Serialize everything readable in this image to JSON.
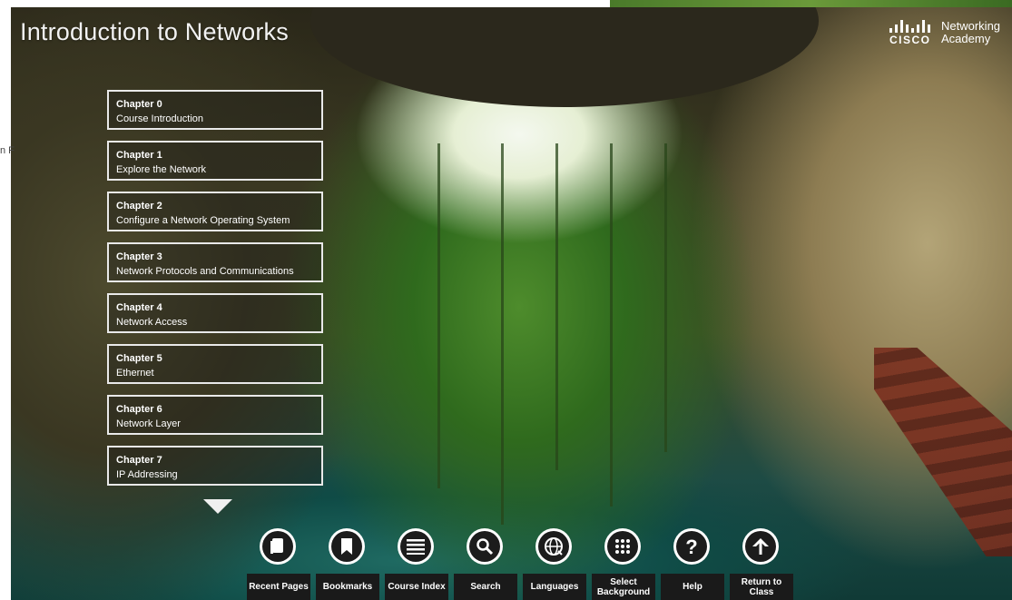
{
  "course": {
    "title": "Introduction to Networks"
  },
  "logo": {
    "wordmark": "CISCO",
    "line1": "Networking",
    "line2": "Academy"
  },
  "left_remnant": {
    "text": "n F"
  },
  "chapters": [
    {
      "number": "Chapter 0",
      "name": "Course Introduction"
    },
    {
      "number": "Chapter 1",
      "name": "Explore the Network"
    },
    {
      "number": "Chapter 2",
      "name": "Configure a Network Operating System"
    },
    {
      "number": "Chapter 3",
      "name": "Network Protocols and Communications"
    },
    {
      "number": "Chapter 4",
      "name": "Network Access"
    },
    {
      "number": "Chapter 5",
      "name": "Ethernet"
    },
    {
      "number": "Chapter 6",
      "name": "Network Layer"
    },
    {
      "number": "Chapter 7",
      "name": "IP Addressing"
    }
  ],
  "toolbar": {
    "items": [
      {
        "label": "Recent Pages",
        "icon": "recent-pages-icon"
      },
      {
        "label": "Bookmarks",
        "icon": "bookmark-icon"
      },
      {
        "label": "Course Index",
        "icon": "list-icon"
      },
      {
        "label": "Search",
        "icon": "search-icon"
      },
      {
        "label": "Languages",
        "icon": "globe-icon"
      },
      {
        "label": "Select Background",
        "icon": "grid-icon"
      },
      {
        "label": "Help",
        "icon": "help-icon"
      },
      {
        "label": "Return to Class",
        "icon": "arrow-up-icon"
      }
    ]
  },
  "colors": {
    "menu_border": "#e9e9e9",
    "toolbar_bg": "#1a1a1a",
    "icon_bg": "#1c1c1c"
  }
}
